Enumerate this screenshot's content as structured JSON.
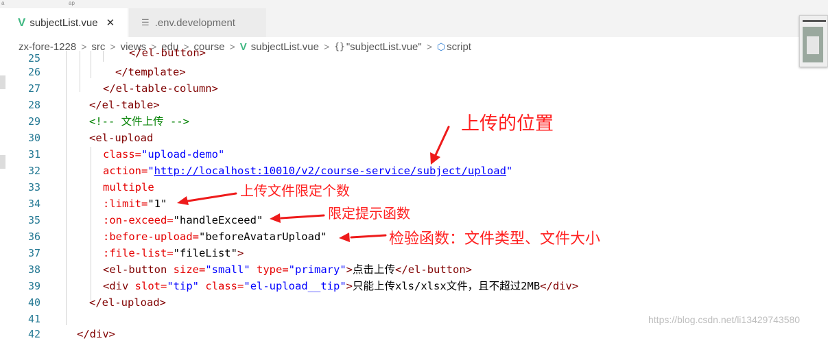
{
  "topstrip": {
    "fragment_left": "a",
    "fragment_mid": "ap"
  },
  "tabs": [
    {
      "label": "subjectList.vue",
      "icon": "vue-icon",
      "close": "✕",
      "active": true
    },
    {
      "label": ".env.development",
      "icon": "file-icon",
      "active": false
    }
  ],
  "breadcrumb": {
    "items": [
      "zx-fore-1228",
      "src",
      "views",
      "edu",
      "course",
      "subjectList.vue",
      "\"subjectList.vue\"",
      "script"
    ],
    "separator": ">",
    "braces": "{}"
  },
  "editor": {
    "lines": [
      {
        "n": "25",
        "code": "</el-button>"
      },
      {
        "n": "26",
        "code": "</template>"
      },
      {
        "n": "27",
        "code": "</el-table-column>"
      },
      {
        "n": "28",
        "code": "</el-table>"
      },
      {
        "n": "29",
        "code": "<!-- 文件上传 -->"
      },
      {
        "n": "30",
        "code": "<el-upload"
      },
      {
        "n": "31",
        "code": "class=\"upload-demo\""
      },
      {
        "n": "32",
        "code": "action=\"http://localhost:10010/v2/course-service/subject/upload\""
      },
      {
        "n": "33",
        "code": "multiple"
      },
      {
        "n": "34",
        "code": ":limit=\"1\""
      },
      {
        "n": "35",
        "code": ":on-exceed=\"handleExceed\""
      },
      {
        "n": "36",
        "code": ":before-upload=\"beforeAvatarUpload\""
      },
      {
        "n": "37",
        "code": ":file-list=\"fileList\">"
      },
      {
        "n": "38",
        "code": "<el-button size=\"small\" type=\"primary\">点击上传</el-button>"
      },
      {
        "n": "39",
        "code": "<div slot=\"tip\" class=\"el-upload__tip\">只能上传xls/xlsx文件，且不超过2MB</div>"
      },
      {
        "n": "40",
        "code": "</el-upload>"
      },
      {
        "n": "41",
        "code": ""
      },
      {
        "n": "42",
        "code": "</div>"
      }
    ]
  },
  "annotations": {
    "upload_location": "上传的位置",
    "limit_count": "上传文件限定个数",
    "exceed_handler": "限定提示函数",
    "validate_fn": "检验函数：文件类型、文件大小"
  },
  "watermark": "https://blog.csdn.net/li13429743580",
  "colors": {
    "tag": "#800000",
    "attribute": "#e50000",
    "string": "#0000ff",
    "comment": "#008000",
    "line_number": "#237893",
    "annotation": "#ff2020",
    "vue_green": "#41b883"
  }
}
